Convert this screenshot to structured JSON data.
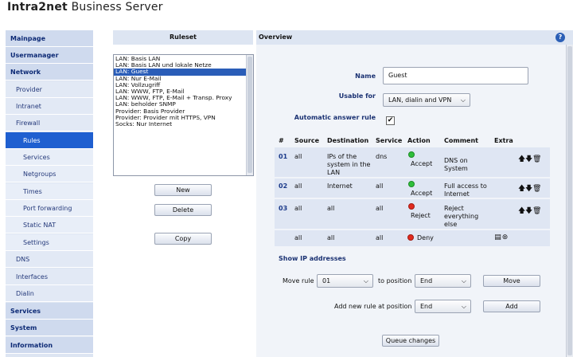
{
  "app": {
    "brand_bold": "Intra2net",
    "brand_rest": " Business Server"
  },
  "sidebar": {
    "items": [
      {
        "label": "Mainpage"
      },
      {
        "label": "Usermanager"
      },
      {
        "label": "Network"
      },
      {
        "label": "Provider"
      },
      {
        "label": "Intranet"
      },
      {
        "label": "Firewall"
      },
      {
        "label": "Rules"
      },
      {
        "label": "Services"
      },
      {
        "label": "Netgroups"
      },
      {
        "label": "Times"
      },
      {
        "label": "Port forwarding"
      },
      {
        "label": "Static NAT"
      },
      {
        "label": "Settings"
      },
      {
        "label": "DNS"
      },
      {
        "label": "Interfaces"
      },
      {
        "label": "Dialin"
      },
      {
        "label": "Services"
      },
      {
        "label": "System"
      },
      {
        "label": "Information"
      }
    ]
  },
  "ruleset": {
    "title": "Ruleset",
    "items": [
      {
        "label": "LAN: Basis LAN"
      },
      {
        "label": "LAN: Basis LAN und lokale Netze"
      },
      {
        "label": "LAN: Guest"
      },
      {
        "label": "LAN: Nur E-Mail"
      },
      {
        "label": "LAN: Vollzugriff"
      },
      {
        "label": "LAN: WWW, FTP, E-Mail"
      },
      {
        "label": "LAN: WWW, FTP, E-Mail + Transp. Proxy"
      },
      {
        "label": "LAN: beholder SNMP"
      },
      {
        "label": "Provider: Basis Provider"
      },
      {
        "label": "Provider: Provider mit HTTPS, VPN"
      },
      {
        "label": "Socks: Nur Internet"
      }
    ],
    "selected": "LAN: Guest",
    "buttons": {
      "new": "New",
      "delete": "Delete",
      "copy": "Copy"
    }
  },
  "overview": {
    "title": "Overview",
    "help": "?",
    "name_label": "Name",
    "name_value": "Guest",
    "usable_label": "Usable for",
    "usable_value": "LAN, dialin and VPN",
    "auto_label": "Automatic answer rule",
    "auto_checked": true,
    "auto_mark": "✔",
    "columns": [
      "#",
      "Source",
      "Destination",
      "Service",
      "Action",
      "Comment",
      "Extra"
    ],
    "rules": [
      {
        "num": "01",
        "source": "all",
        "destination": "IPs of the system in the LAN",
        "service": "dns",
        "action": "Accept",
        "action_color": "green",
        "comment": "DNS on System"
      },
      {
        "num": "02",
        "source": "all",
        "destination": "Internet",
        "service": "all",
        "action": "Accept",
        "action_color": "green",
        "comment": "Full access to Internet"
      },
      {
        "num": "03",
        "source": "all",
        "destination": "all",
        "service": "all",
        "action": "Reject",
        "action_color": "red",
        "comment": "Reject everything else"
      }
    ],
    "default_rule": {
      "source": "all",
      "destination": "all",
      "service": "all",
      "action": "Deny",
      "action_color": "red"
    },
    "extra_icons": {
      "up": "🡅",
      "down": "🡇",
      "delete": "🗑",
      "log": "▤",
      "settings": "⊛"
    },
    "show_ip": "Show IP addresses",
    "move_label": "Move rule",
    "move_value": "01",
    "to_position_label": "to position",
    "to_position_value": "End",
    "move_button": "Move",
    "add_label": "Add new rule at position",
    "add_position_value": "End",
    "add_button": "Add",
    "queue_button": "Queue changes"
  },
  "colors": {
    "accent": "#1f5fd0",
    "sidebar_bg": "#dde5f2",
    "row_bg": "#dfe6f3"
  }
}
